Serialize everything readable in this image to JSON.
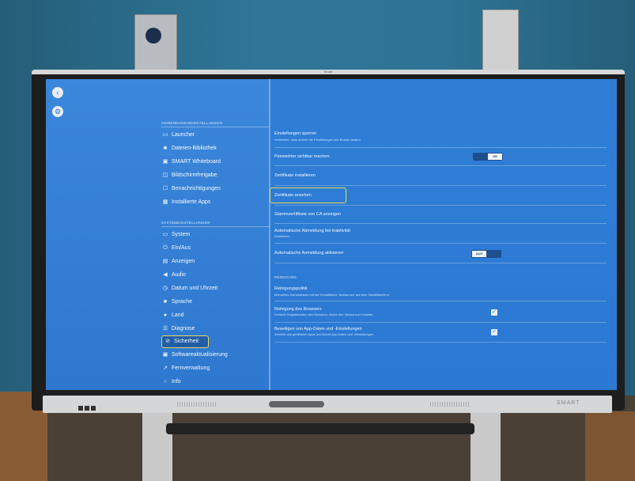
{
  "frame_label": "Smart",
  "bottom_brand": "SMART",
  "left_rail": {
    "back_icon": "‹",
    "settings_icon": "⚙"
  },
  "app_section": {
    "header": "ANWENDUNGSEINSTELLUNGEN",
    "items": [
      {
        "icon": "▭",
        "label": "Launcher"
      },
      {
        "icon": "■",
        "label": "Dateien-Bibliothek"
      },
      {
        "icon": "▣",
        "label": "SMART Whiteboard"
      },
      {
        "icon": "◫",
        "label": "Bildschirmfreigabe"
      },
      {
        "icon": "☐",
        "label": "Benachrichtigungen"
      },
      {
        "icon": "▦",
        "label": "Installierte Apps"
      }
    ]
  },
  "system_section": {
    "header": "SYSTEMEINSTELLUNGEN",
    "items": [
      {
        "icon": "▭",
        "label": "System"
      },
      {
        "icon": "⏻",
        "label": "Ein/Aus"
      },
      {
        "icon": "▤",
        "label": "Anzeigen"
      },
      {
        "icon": "◀",
        "label": "Audio"
      },
      {
        "icon": "◷",
        "label": "Datum und Uhrzeit"
      },
      {
        "icon": "■",
        "label": "Sprache"
      },
      {
        "icon": "●",
        "label": "Land"
      },
      {
        "icon": "☰",
        "label": "Diagnose"
      },
      {
        "icon": "⊘",
        "label": "Sicherheit"
      },
      {
        "icon": "▣",
        "label": "Softwareaktualisierung"
      },
      {
        "icon": "↗",
        "label": "Fernverwaltung"
      },
      {
        "icon": "○",
        "label": "Info"
      }
    ]
  },
  "settings": [
    {
      "title": "Einstellungen sperren",
      "subtitle": "Verhindert, dass andere die Einstellungen des Boards ändern"
    },
    {
      "title": "Passwörter sichtbar machen",
      "toggle": "AN"
    },
    {
      "title": "Zertifikate installieren"
    },
    {
      "title": "Zertifikate ansehen"
    },
    {
      "title": "Stammzertifikate von CA anzeigen"
    },
    {
      "title": "Automatische Abmeldung bei Inaktivität",
      "subtitle": "Deaktiviert"
    },
    {
      "title": "Automatische Anmeldung aktivieren",
      "toggle": "AUS"
    }
  ],
  "cleaning": {
    "header": "REINIGUNG",
    "items": [
      {
        "title": "Reinigungspolitik",
        "subtitle": "Manuelles Zurücksetzen mit der Schaltfläche 'Aufräumen' auf dem Startbildschirm"
      },
      {
        "title": "Reinigung des Browsers",
        "subtitle": "Schließt Registerkarten des Browsers, löscht den Verlauf und Cookies",
        "checked": "✓"
      },
      {
        "title": "Beseitigen von App-Daten und -Einstellungen",
        "subtitle": "Schließt alle geöffneten Apps und löscht App-Daten und -Einstellungen",
        "checked": "✓"
      }
    ]
  }
}
